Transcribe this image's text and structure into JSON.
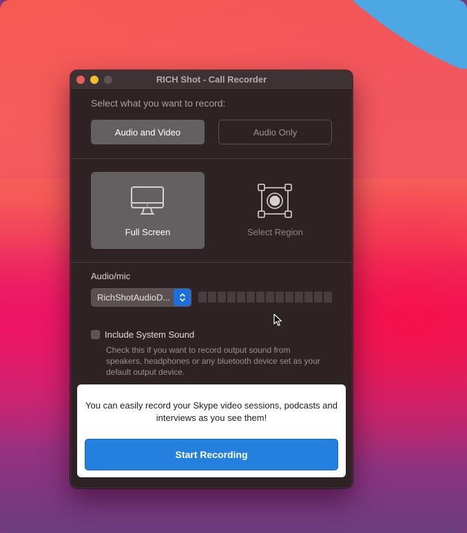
{
  "window": {
    "title": "RICH Shot - Call Recorder",
    "traffic_lights": [
      "close",
      "minimize",
      "zoom"
    ]
  },
  "record_type": {
    "prompt": "Select what you want to record:",
    "options": [
      {
        "label": "Audio and Video",
        "selected": true
      },
      {
        "label": "Audio Only",
        "selected": false
      }
    ]
  },
  "capture_mode": {
    "options": [
      {
        "label": "Full Screen",
        "icon": "monitor-icon",
        "selected": true
      },
      {
        "label": "Select Region",
        "icon": "select-region-icon",
        "selected": false
      }
    ]
  },
  "audio": {
    "label": "Audio/mic",
    "device_selected": "RichShotAudioD...",
    "level_meter": {
      "segments": 14,
      "level": 0
    }
  },
  "system_sound": {
    "label": "Include System Sound",
    "checked": false,
    "help": "Check this if you want to record output sound from speakers, headphones or any bluetooth device set as your default output device."
  },
  "promo": {
    "text": "You can easily record your Skype video sessions, podcasts and interviews as you see them!",
    "button_label": "Start Recording"
  },
  "colors": {
    "accent_blue": "#2480de",
    "close": "#ed5f58",
    "minimize": "#f3bc2e",
    "window_bg": "#2f2225"
  }
}
